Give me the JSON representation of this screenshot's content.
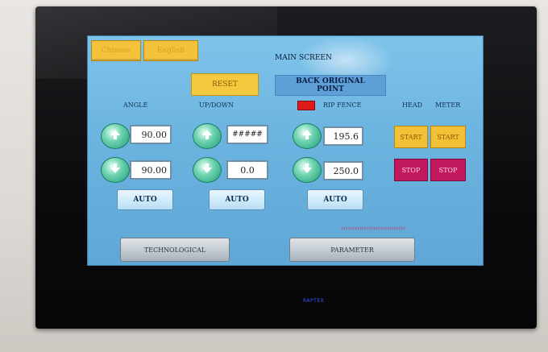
{
  "languages": {
    "chinese": "Chinese",
    "english": "English"
  },
  "title": "MAIN SCREEN",
  "reset_label": "RESET",
  "back_original_point": {
    "line1": "BACK ORIGINAL",
    "line2": "POINT"
  },
  "headers": {
    "angle": "ANGLE",
    "updown": "UP/DOWN",
    "rip_fence": "RIP FENCE",
    "head": "HEAD",
    "meter": "METER"
  },
  "values": {
    "angle_top": "90.00",
    "angle_bottom": "90.00",
    "updown_top": "#####",
    "updown_bottom": "0.0",
    "rip_top": "195.6",
    "rip_bottom": "250.0"
  },
  "auto_label": "AUTO",
  "start_label": "START",
  "stop_label": "STOP",
  "bottom_buttons": {
    "technological": "TECHNOLOGICAL",
    "parameter": "PARAMETER"
  },
  "status_message": "????????????????????????????",
  "bezel_brand": "RAPTEX",
  "colors": {
    "screen_bg": "#6bb4e0",
    "start": "#f2c236",
    "stop": "#c2195e",
    "indicator": "#e01919"
  },
  "icons": [
    "arrow-up-icon",
    "arrow-down-icon"
  ]
}
